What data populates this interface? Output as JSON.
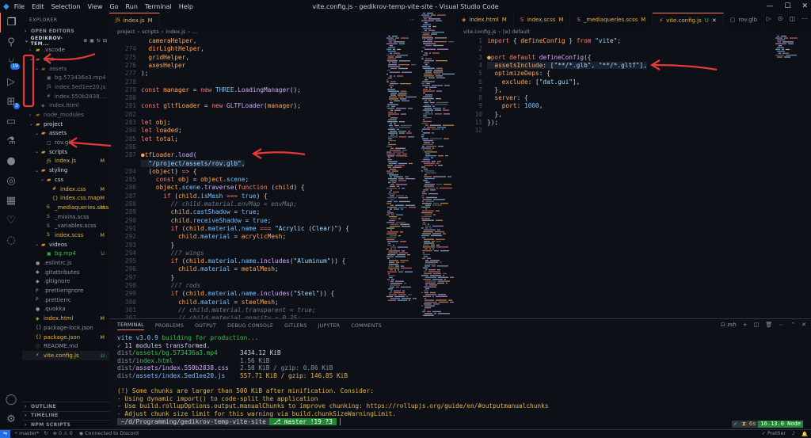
{
  "titlebar": {
    "menus": [
      "File",
      "Edit",
      "Selection",
      "View",
      "Go",
      "Run",
      "Terminal",
      "Help"
    ],
    "title": "vite.config.js - gedikrov-temp-vite-site - Visual Studio Code",
    "min": "—",
    "max": "☐",
    "close": "✕"
  },
  "activity": {
    "scm_badge": "19",
    "ext_badge": "3"
  },
  "explorer": {
    "header": "EXPLORER",
    "open_editors": "OPEN EDITORS",
    "project": "GEDIKROV-TEM...",
    "tree": [
      {
        "name": ".vscode",
        "depth": 1,
        "type": "folder",
        "open": false,
        "color": "#8b949e"
      },
      {
        "name": "dist",
        "depth": 1,
        "type": "folder",
        "open": true,
        "color": "#6e7681"
      },
      {
        "name": "assets",
        "depth": 2,
        "type": "folder",
        "open": true,
        "color": "#6e7681"
      },
      {
        "name": "bg.573436a3.mp4",
        "depth": 3,
        "type": "file",
        "color": "#6e7681",
        "icon": "▣"
      },
      {
        "name": "index.5ed1ee20.js",
        "depth": 3,
        "type": "file",
        "color": "#6e7681",
        "icon": "JS"
      },
      {
        "name": "index.550b2838.css",
        "depth": 3,
        "type": "file",
        "color": "#6e7681",
        "icon": "#"
      },
      {
        "name": "index.html",
        "depth": 2,
        "type": "file",
        "color": "#6e7681",
        "icon": "◈"
      },
      {
        "name": "node_modules",
        "depth": 1,
        "type": "folder",
        "open": false,
        "color": "#6e7681"
      },
      {
        "name": "project",
        "depth": 1,
        "type": "folder",
        "open": true,
        "color": "#c9d1d9"
      },
      {
        "name": "assets",
        "depth": 2,
        "type": "folder",
        "open": true,
        "color": "#c9d1d9"
      },
      {
        "name": "rov.glb",
        "depth": 3,
        "type": "file",
        "color": "#8b949e",
        "icon": "▢"
      },
      {
        "name": "scripts",
        "depth": 2,
        "type": "folder",
        "open": true,
        "color": "#c9d1d9"
      },
      {
        "name": "index.js",
        "depth": 3,
        "type": "file",
        "color": "#e3b341",
        "icon": "JS",
        "status": "M",
        "statusColor": "#e3b341"
      },
      {
        "name": "styling",
        "depth": 2,
        "type": "folder",
        "open": true,
        "color": "#c9d1d9"
      },
      {
        "name": "css",
        "depth": 3,
        "type": "folder",
        "open": true,
        "color": "#c9d1d9"
      },
      {
        "name": "index.css",
        "depth": 4,
        "type": "file",
        "color": "#e3b341",
        "icon": "#",
        "status": "M",
        "statusColor": "#e3b341"
      },
      {
        "name": "index.css.map",
        "depth": 4,
        "type": "file",
        "color": "#e3b341",
        "icon": "{}",
        "status": "M",
        "statusColor": "#e3b341"
      },
      {
        "name": "_mediaqueries.scss",
        "depth": 3,
        "type": "file",
        "color": "#e3b341",
        "icon": "S",
        "status": "M",
        "statusColor": "#e3b341"
      },
      {
        "name": "_mixins.scss",
        "depth": 3,
        "type": "file",
        "color": "#8b949e",
        "icon": "S"
      },
      {
        "name": "_variables.scss",
        "depth": 3,
        "type": "file",
        "color": "#8b949e",
        "icon": "S"
      },
      {
        "name": "index.scss",
        "depth": 3,
        "type": "file",
        "color": "#e3b341",
        "icon": "S",
        "status": "M",
        "statusColor": "#e3b341"
      },
      {
        "name": "videos",
        "depth": 2,
        "type": "folder",
        "open": true,
        "color": "#c9d1d9"
      },
      {
        "name": "bg.mp4",
        "depth": 3,
        "type": "file",
        "color": "#3fb950",
        "icon": "▣",
        "status": "U",
        "statusColor": "#3fb950"
      },
      {
        "name": ".eslintrc.js",
        "depth": 1,
        "type": "file",
        "color": "#8b949e",
        "icon": "●"
      },
      {
        "name": ".gitattributes",
        "depth": 1,
        "type": "file",
        "color": "#8b949e",
        "icon": "◆"
      },
      {
        "name": ".gitignore",
        "depth": 1,
        "type": "file",
        "color": "#8b949e",
        "icon": "◆"
      },
      {
        "name": ".prettierignore",
        "depth": 1,
        "type": "file",
        "color": "#8b949e",
        "icon": "P"
      },
      {
        "name": ".prettierrc",
        "depth": 1,
        "type": "file",
        "color": "#8b949e",
        "icon": "P"
      },
      {
        "name": ".quokka",
        "depth": 1,
        "type": "file",
        "color": "#8b949e",
        "icon": "●"
      },
      {
        "name": "index.html",
        "depth": 1,
        "type": "file",
        "color": "#e3b341",
        "icon": "◈",
        "status": "M",
        "statusColor": "#e3b341"
      },
      {
        "name": "package-lock.json",
        "depth": 1,
        "type": "file",
        "color": "#8b949e",
        "icon": "{}"
      },
      {
        "name": "package.json",
        "depth": 1,
        "type": "file",
        "color": "#e3b341",
        "icon": "{}",
        "status": "M",
        "statusColor": "#e3b341"
      },
      {
        "name": "README.md",
        "depth": 1,
        "type": "file",
        "color": "#8b949e",
        "icon": "ⓘ"
      },
      {
        "name": "vite.config.js",
        "depth": 1,
        "type": "file",
        "color": "#e3b341",
        "icon": "⚡",
        "status": "U",
        "statusColor": "#3fb950"
      }
    ],
    "sections": [
      "OUTLINE",
      "TIMELINE",
      "NPM SCRIPTS"
    ]
  },
  "editor_left": {
    "tab": {
      "name": "index.js",
      "status": "M"
    },
    "breadcrumb": [
      "project",
      "scripts",
      "index.js",
      "..."
    ],
    "lines": [
      {
        "n": "",
        "html": "  <span class=\"va\">cameraHelper</span>,"
      },
      {
        "n": "274",
        "html": "  <span class=\"va\">dirLightHelper</span>,"
      },
      {
        "n": "275",
        "html": "  <span class=\"va\">gridHelper</span>,"
      },
      {
        "n": "276",
        "html": "  <span class=\"va\">axesHelper</span>"
      },
      {
        "n": "277",
        "html": ");"
      },
      {
        "n": "278",
        "html": ""
      },
      {
        "n": "279",
        "html": "<span class=\"kw\">const</span> <span class=\"va\">manager</span> = <span class=\"kw\">new</span> <span class=\"pr\">THREE</span>.<span class=\"fn\">LoadingManager</span>();"
      },
      {
        "n": "280",
        "html": ""
      },
      {
        "n": "281",
        "html": "<span class=\"kw\">const</span> <span class=\"va\">gltfLoader</span> = <span class=\"kw\">new</span> <span class=\"fn\">GLTFLoader</span>(<span class=\"va\">manager</span>);"
      },
      {
        "n": "282",
        "html": ""
      },
      {
        "n": "283",
        "html": "<span class=\"kw\">let</span> <span class=\"va\">obj</span>;"
      },
      {
        "n": "284",
        "html": "<span class=\"kw\">let</span> <span class=\"va\">loaded</span>;"
      },
      {
        "n": "285",
        "html": "<span class=\"kw\">let</span> <span class=\"va\">total</span>;"
      },
      {
        "n": "286",
        "html": ""
      },
      {
        "n": "287",
        "html": "<span style=\"color:#e3b341\">●</span><span class=\"va\">tfLoader</span>.<span class=\"fn\">load</span>("
      },
      {
        "n": "",
        "html": "  <span class=\"str\" style=\"background:#1c2a3a\">\"/project/assets/rov.glb\"</span>,"
      },
      {
        "n": "284",
        "html": "  (<span class=\"va\">object</span>) <span class=\"kw\">=&gt;</span> {"
      },
      {
        "n": "285",
        "html": "    <span class=\"kw\">const</span> <span class=\"va\">obj</span> = <span class=\"va\">object</span>.<span class=\"pr\">scene</span>;"
      },
      {
        "n": "286",
        "html": "    <span class=\"va\">object</span>.<span class=\"pr\">scene</span>.<span class=\"fn\">traverse</span>(<span class=\"kw\">function</span> (<span class=\"va\">child</span>) {"
      },
      {
        "n": "287",
        "html": "      <span class=\"kw\">if</span> (<span class=\"va\">child</span>.<span class=\"pr\">isMesh</span> <span class=\"kw\">===</span> <span class=\"num\">true</span>) {"
      },
      {
        "n": "288",
        "html": "        <span class=\"cm\">// child.material.envMap = envMap;</span>"
      },
      {
        "n": "289",
        "html": "        <span class=\"va\">child</span>.<span class=\"pr\">castShadow</span> = <span class=\"num\">true</span>;"
      },
      {
        "n": "290",
        "html": "        <span class=\"va\">child</span>.<span class=\"pr\">receiveShadow</span> = <span class=\"num\">true</span>;"
      },
      {
        "n": "291",
        "html": "        <span class=\"kw\">if</span> (<span class=\"va\">child</span>.<span class=\"pr\">material</span>.<span class=\"pr\">name</span> <span class=\"kw\">===</span> <span class=\"str\">\"Acrylic (Clear)\"</span>) {"
      },
      {
        "n": "292",
        "html": "          <span class=\"va\">child</span>.<span class=\"pr\">material</span> = <span class=\"va\">acrylicMesh</span>;"
      },
      {
        "n": "293",
        "html": "        }"
      },
      {
        "n": "294",
        "html": "        <span class=\"cm\">//? wings</span>"
      },
      {
        "n": "295",
        "html": "        <span class=\"kw\">if</span> (<span class=\"va\">child</span>.<span class=\"pr\">material</span>.<span class=\"pr\">name</span>.<span class=\"fn\">includes</span>(<span class=\"str\">\"Aluminum\"</span>)) {"
      },
      {
        "n": "296",
        "html": "          <span class=\"va\">child</span>.<span class=\"pr\">material</span> = <span class=\"va\">metalMesh</span>;"
      },
      {
        "n": "297",
        "html": "        }"
      },
      {
        "n": "298",
        "html": "        <span class=\"cm\">//? rods</span>"
      },
      {
        "n": "299",
        "html": "        <span class=\"kw\">if</span> (<span class=\"va\">child</span>.<span class=\"pr\">material</span>.<span class=\"pr\">name</span>.<span class=\"fn\">includes</span>(<span class=\"str\">\"Steel\"</span>)) {"
      },
      {
        "n": "300",
        "html": "          <span class=\"va\">child</span>.<span class=\"pr\">material</span> = <span class=\"va\">steelMesh</span>;"
      },
      {
        "n": "301",
        "html": "          <span class=\"cm\">// child.material.transparent = true;</span>"
      },
      {
        "n": "302",
        "html": "          <span class=\"cm\">// child.material.opacity = 0.25;</span>"
      },
      {
        "n": "303",
        "html": "        }"
      }
    ]
  },
  "editor_right": {
    "tabs": [
      {
        "name": "index.html",
        "status": "M",
        "active": false,
        "color": "#e3b341"
      },
      {
        "name": "index.scss",
        "status": "M",
        "active": false,
        "color": "#e3b341"
      },
      {
        "name": "_mediaqueries.scss",
        "status": "M",
        "active": false,
        "color": "#e3b341"
      },
      {
        "name": "vite.config.js",
        "status": "U",
        "active": true,
        "color": "#e3b341"
      },
      {
        "name": "rov.glb",
        "status": "",
        "active": false,
        "color": "#8b949e"
      }
    ],
    "breadcrumb": [
      "vite.config.js",
      "[e] default"
    ],
    "lines": [
      {
        "n": "1",
        "html": "<span class=\"kw\">import</span> { <span class=\"va\">defineConfig</span> } <span class=\"kw\">from</span> <span class=\"str\">\"vite\"</span>;"
      },
      {
        "n": "2",
        "html": ""
      },
      {
        "n": "3",
        "html": "<span style=\"color:#e3b341\">●</span><span class=\"kw\">port default</span> <span class=\"fn\">defineConfig</span>({"
      },
      {
        "n": "4",
        "html": "  <span class=\"va\">assetsInclude</span>: [<span class=\"str\">\"**/*.glb\"</span>, <span class=\"str\">\"**/*.gltf\"</span>],"
      },
      {
        "n": "5",
        "html": "  <span class=\"va\">optimizeDeps</span>: {"
      },
      {
        "n": "6",
        "html": "    <span class=\"va\">exclude</span>: [<span class=\"str\">\"dat.gui\"</span>],"
      },
      {
        "n": "7",
        "html": "  },"
      },
      {
        "n": "8",
        "html": "  <span class=\"va\">server</span>: {"
      },
      {
        "n": "9",
        "html": "    <span class=\"va\">port</span>: <span class=\"num\">1000</span>,"
      },
      {
        "n": "10",
        "html": "  },"
      },
      {
        "n": "11",
        "html": "});"
      },
      {
        "n": "12",
        "html": ""
      }
    ]
  },
  "panel": {
    "tabs": [
      "TERMINAL",
      "PROBLEMS",
      "OUTPUT",
      "DEBUG CONSOLE",
      "GITLENS",
      "JUPYTER",
      "COMMENTS"
    ],
    "shell": "zsh",
    "terminal": [
      {
        "html": "<span style=\"color:#79c0ff\">vite v3.0.9</span> <span style=\"color:#3fb950\">building for production...</span>"
      },
      {
        "html": "<span style=\"color:#3fb950\">✓</span> 11 modules transformed."
      },
      {
        "html": "<span style=\"color:#8b949e\">dist/</span><span style=\"color:#3fb950\">assets/bg.573436a3.mp4</span>      <span style=\"color:#c9d1d9\">3434.12 KiB</span>"
      },
      {
        "html": "<span style=\"color:#8b949e\">dist/</span><span style=\"color:#3fb950\">index.html</span>                  <span style=\"color:#8b949e\">1.56 KiB</span>"
      },
      {
        "html": "<span style=\"color:#8b949e\">dist/</span><span style=\"color:#d2a8ff\">assets/index.550b2838.css</span>   <span style=\"color:#8b949e\">2.50 KiB / gzip: 0.86 KiB</span>"
      },
      {
        "html": "<span style=\"color:#8b949e\">dist/</span><span style=\"color:#79c0ff\">assets/index.5ed1ee20.js</span>    <span style=\"color:#e3b341\">557.71 KiB / gzip: 146.85 KiB</span>"
      },
      {
        "html": ""
      },
      {
        "html": "<span style=\"color:#e3b341\">(!) Some chunks are larger than 500 KiB after minification. Consider:</span>"
      },
      {
        "html": "<span style=\"color:#e3b341\">- Using dynamic import() to code-split the application</span>"
      },
      {
        "html": "<span style=\"color:#e3b341\">- Use build.rollupOptions.output.manualChunks to improve chunking: https://rollupjs.org/guide/en/#outputmanualchunks</span>"
      },
      {
        "html": "<span style=\"color:#e3b341\">- Adjust chunk size limit for this warning via build.chunkSizeWarningLimit.</span>"
      },
      {
        "html": "<span style=\"background:#30363d;color:#c9d1d9\"> ~/d/Programming/gedikrov-temp-vite-site </span><span style=\"background:#238636;color:#fff\"> ⎇ master !19 ?3 </span> <span style=\"color:#c9d1d9\">▏</span>"
      }
    ],
    "right_status": [
      "✔",
      "6s",
      "16.13.0 Node"
    ]
  },
  "statusbar": {
    "branch": "master*",
    "sync": "↻",
    "errors": "⊗ 0 ⚠ 0",
    "discord": "Connected to Discord",
    "right": [
      "✓ Prettier",
      "♪",
      "🔔"
    ]
  },
  "colors": {
    "annotation_arrow": "#e53935",
    "accent": "#1f6feb"
  }
}
